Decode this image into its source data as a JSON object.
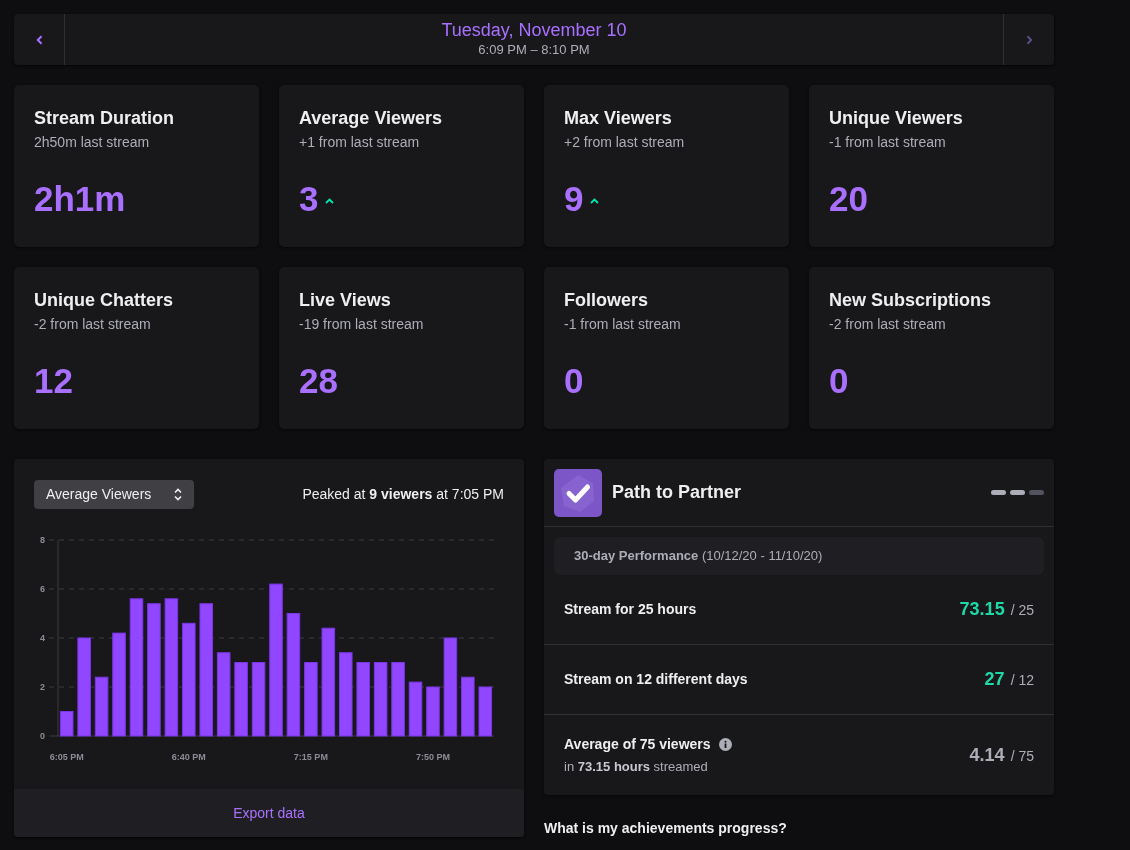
{
  "date_nav": {
    "title": "Tuesday, November 10",
    "time_range": "6:09 PM – 8:10 PM",
    "prev": {
      "disabled": false
    },
    "next": {
      "disabled": true
    }
  },
  "stats": [
    {
      "title": "Stream Duration",
      "comparison": "2h50m last stream",
      "value": "2h1m"
    },
    {
      "title": "Average Viewers",
      "comparison": "+1 from last stream",
      "value": "3",
      "rising": true
    },
    {
      "title": "Max Viewers",
      "comparison": "+2 from last stream",
      "value": "9",
      "rising": true
    },
    {
      "title": "Unique Viewers",
      "comparison": "-1 from last stream",
      "value": "20"
    },
    {
      "title": "Unique Chatters",
      "comparison": "-2 from last stream",
      "value": "12"
    },
    {
      "title": "Live Views",
      "comparison": "-19 from last stream",
      "value": "28"
    },
    {
      "title": "Followers",
      "comparison": "-1 from last stream",
      "value": "0"
    },
    {
      "title": "New Subscriptions",
      "comparison": "-2 from last stream",
      "value": "0"
    }
  ],
  "chart_panel": {
    "metric": "Average Viewers",
    "peak": "Peaked at **9 viewers** at 7:05 PM",
    "chart_data": {
      "type": "bar",
      "categories": [
        "6:05 PM",
        null,
        null,
        null,
        null,
        null,
        null,
        "6:40 PM",
        null,
        null,
        null,
        null,
        null,
        null,
        "7:15 PM",
        null,
        null,
        null,
        null,
        null,
        null,
        "7:50 PM",
        null,
        null,
        null
      ],
      "values": [
        1,
        4,
        2.4,
        4.2,
        5.6,
        5.4,
        5.6,
        4.6,
        5.4,
        3.4,
        3,
        3,
        6.2,
        5,
        3,
        4.4,
        3.4,
        3,
        3,
        3,
        2.2,
        2,
        4,
        2.4,
        2
      ],
      "ylim": [
        0,
        8
      ],
      "yticks": [
        0,
        2,
        4,
        6,
        8
      ],
      "grid": true
    },
    "export": "Export data"
  },
  "partner": {
    "title": "Path to Partner",
    "steps": [
      {
        "done": true
      },
      {
        "done": true
      },
      {
        "done": false
      }
    ],
    "period": "**30-day Performance** (10/12/20 - 11/10/20)",
    "goals": [
      {
        "label": "Stream for 25 hours",
        "value": "73.15",
        "target": "/ 25",
        "met": true
      },
      {
        "label": "Stream on 12 different days",
        "value": "27",
        "target": "/ 12",
        "met": true
      },
      {
        "label": "Average of 75 viewers",
        "info": true,
        "detail": "in **73.15 hours** streamed",
        "value": "4.14",
        "target": "/ 75",
        "met": false
      }
    ]
  },
  "question": "What is my achievements progress?"
}
